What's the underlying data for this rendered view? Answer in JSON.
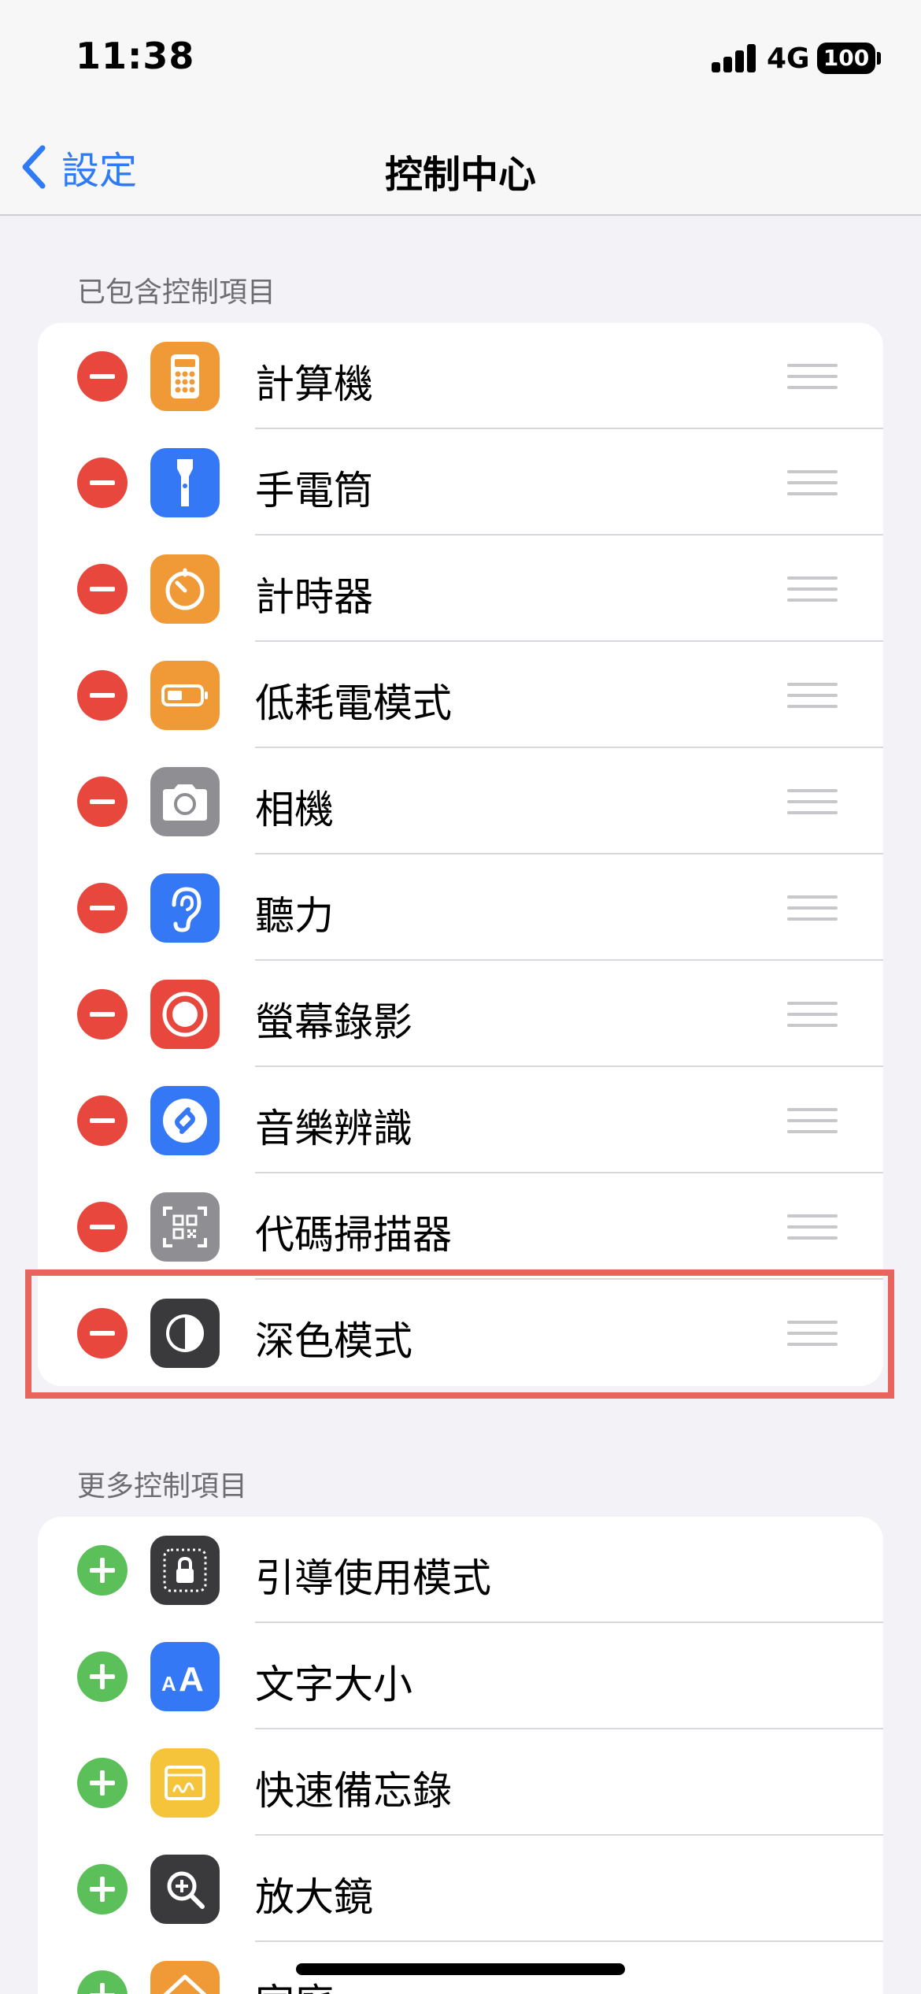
{
  "status_bar": {
    "time": "11:38",
    "network": "4G",
    "battery": "100"
  },
  "nav": {
    "back_label": "設定",
    "title": "控制中心"
  },
  "included": {
    "header": "已包含控制項目",
    "items": [
      {
        "label": "計算機",
        "icon": "calculator-icon",
        "color": "#f09a37"
      },
      {
        "label": "手電筒",
        "icon": "flashlight-icon",
        "color": "#3478f6"
      },
      {
        "label": "計時器",
        "icon": "timer-icon",
        "color": "#f09a37"
      },
      {
        "label": "低耗電模式",
        "icon": "low-power-battery-icon",
        "color": "#f09a37"
      },
      {
        "label": "相機",
        "icon": "camera-icon",
        "color": "#8e8e93"
      },
      {
        "label": "聽力",
        "icon": "ear-icon",
        "color": "#3478f6"
      },
      {
        "label": "螢幕錄影",
        "icon": "screen-record-icon",
        "color": "#e8473e"
      },
      {
        "label": "音樂辨識",
        "icon": "shazam-icon",
        "color": "#3478f6"
      },
      {
        "label": "代碼掃描器",
        "icon": "qr-scanner-icon",
        "color": "#8e8e93"
      },
      {
        "label": "深色模式",
        "icon": "dark-mode-icon",
        "color": "#3a3a3c"
      }
    ]
  },
  "more": {
    "header": "更多控制項目",
    "items": [
      {
        "label": "引導使用模式",
        "icon": "guided-access-icon",
        "color": "#3a3a3c"
      },
      {
        "label": "文字大小",
        "icon": "text-size-icon",
        "color": "#3478f6"
      },
      {
        "label": "快速備忘錄",
        "icon": "quick-note-icon",
        "color": "#f5c43a"
      },
      {
        "label": "放大鏡",
        "icon": "magnifier-icon",
        "color": "#3a3a3c"
      },
      {
        "label": "家庭",
        "icon": "home-icon",
        "color": "#f09a37"
      }
    ]
  },
  "highlight": {
    "color": "#e8645c",
    "target": "深色模式"
  }
}
